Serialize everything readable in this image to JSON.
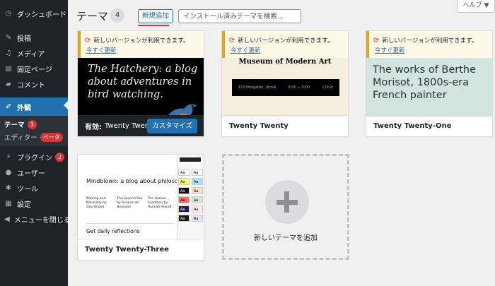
{
  "sidebar": {
    "dashboard": "ダッシュボード",
    "posts": "投稿",
    "media": "メディア",
    "pages": "固定ページ",
    "comments": "コメント",
    "appearance": "外観",
    "sub": {
      "themes": "テーマ",
      "themes_badge": "3",
      "editor": "エディター",
      "editor_badge": "ベータ"
    },
    "plugins": "プラグイン",
    "plugins_badge": "2",
    "users": "ユーザー",
    "tools": "ツール",
    "settings": "設定",
    "collapse": "メニューを閉じる"
  },
  "header": {
    "title": "テーマ",
    "count": "4",
    "add_new": "新規追加",
    "search_placeholder": "インストール済みテーマを検索...",
    "help": "ヘルプ ▼"
  },
  "notice": {
    "text": "新しいバージョンが利用できます。",
    "link": "今すぐ更新"
  },
  "themes": [
    {
      "name": "Twenty Twenty-Three",
      "active_prefix": "有効:",
      "customize": "カスタマイズ",
      "preview_text": "The Hatchery: a blog about adventures in bird watching."
    },
    {
      "name": "Twenty Twenty",
      "preview_head": "Museum of Modern Art",
      "preview_bar": [
        "123 Storgatan, Umeå",
        "9:00 — 5:00",
        "129 kr"
      ]
    },
    {
      "name": "Twenty Twenty-One",
      "preview_text": "The works of Berthe Morisot, 1800s-era French painter"
    },
    {
      "name": "Twenty Twenty-Three",
      "preview_title": "Mindblown: a blog about philosophy.",
      "preview_cols": [
        "Naming and Necessity by Saul Kripke",
        "The Second Sex by Simone de Beauvoir",
        "The Human Condition by Hannah Arendt"
      ],
      "preview_daily": "Get daily reflections",
      "swatch_label": "Aa"
    }
  ],
  "add_theme_label": "新しいテーマを追加"
}
